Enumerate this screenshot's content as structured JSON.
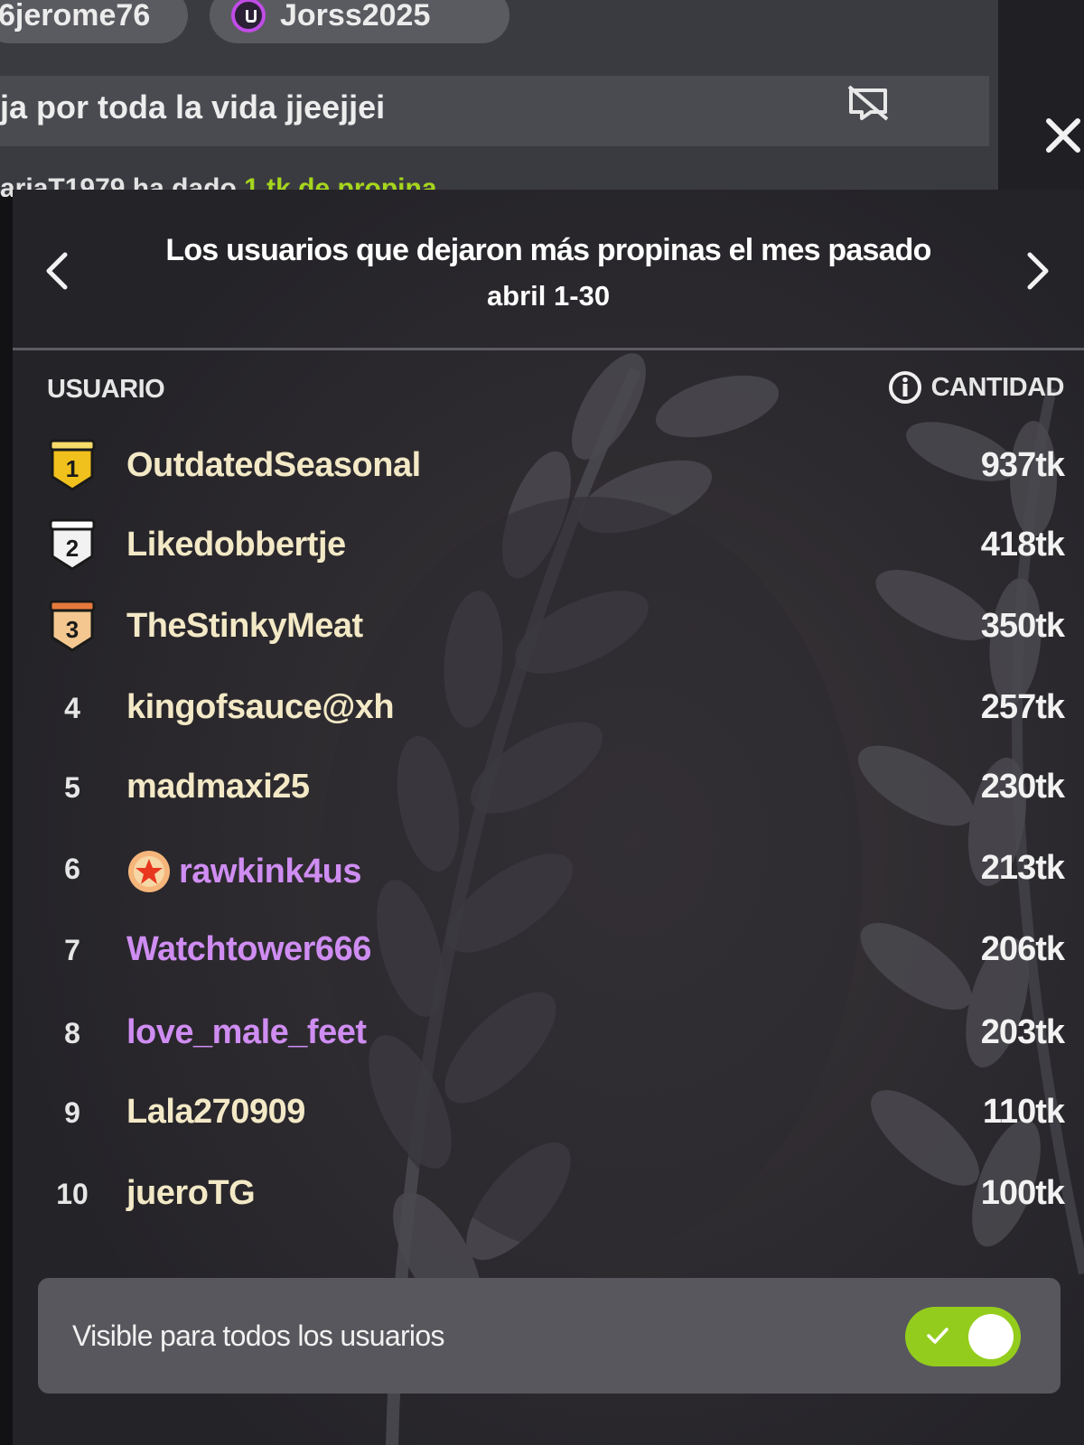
{
  "chat": {
    "user_pill_1": "6jerome76",
    "user_pill_2": "Jorss2025",
    "message": "ja por toda la vida jjeejjei",
    "tip_user": "ariaT1979 ha dado",
    "tip_amount": "1 tk de propina"
  },
  "leaderboard": {
    "title": "Los usuarios que dejaron más propinas el mes pasado",
    "period": "abril 1-30",
    "col_user": "USUARIO",
    "col_amount": "CANTIDAD",
    "rows": [
      {
        "rank": "1",
        "user": "OutdatedSeasonal",
        "amount": "937tk"
      },
      {
        "rank": "2",
        "user": "Likedobbertje",
        "amount": "418tk"
      },
      {
        "rank": "3",
        "user": "TheStinkyMeat",
        "amount": "350tk"
      },
      {
        "rank": "4",
        "user": "kingofsauce@xh",
        "amount": "257tk"
      },
      {
        "rank": "5",
        "user": "madmaxi25",
        "amount": "230tk"
      },
      {
        "rank": "6",
        "user": "rawkink4us",
        "amount": "213tk"
      },
      {
        "rank": "7",
        "user": "Watchtower666",
        "amount": "206tk"
      },
      {
        "rank": "8",
        "user": "love_male_feet",
        "amount": "203tk"
      },
      {
        "rank": "9",
        "user": "Lala270909",
        "amount": "110tk"
      },
      {
        "rank": "10",
        "user": "jueroTG",
        "amount": "100tk"
      }
    ],
    "visible_label": "Visible para todos los usuarios",
    "visible_enabled": true
  },
  "colors": {
    "accent_green": "#94cc1d",
    "username_gold": "#f3e9c6",
    "username_purple": "#cf8df2",
    "panel_bg": "#26252a"
  },
  "icons": [
    "chevron-left-icon",
    "chevron-right-icon",
    "close-icon",
    "hide-message-icon",
    "info-icon",
    "gold-medal-icon",
    "silver-medal-icon",
    "bronze-medal-icon",
    "star-badge-icon",
    "check-icon"
  ]
}
